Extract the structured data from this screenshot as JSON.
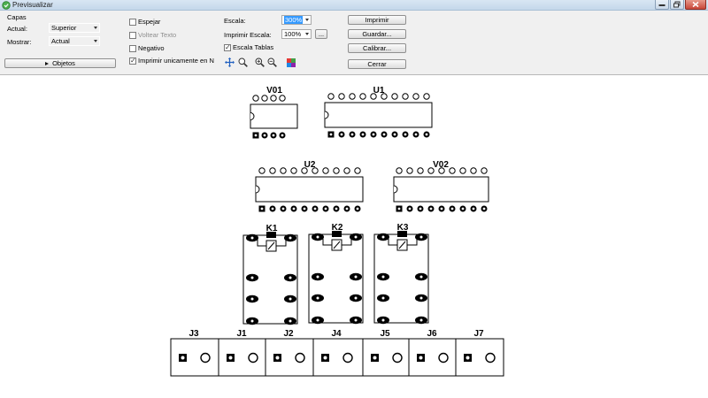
{
  "window": {
    "title": "Previsualizar"
  },
  "capas": {
    "title": "Capas",
    "actual_label": "Actual:",
    "actual_value": "Superior",
    "mostrar_label": "Mostrar:",
    "mostrar_value": "Actual",
    "objetos_button": "Objetos"
  },
  "options": {
    "espejar": {
      "label": "Espejar",
      "checked": false
    },
    "voltear": {
      "label": "Voltear Texto",
      "checked": false,
      "disabled": true
    },
    "negativo": {
      "label": "Negativo",
      "checked": false
    },
    "imprimir_n": {
      "label": "Imprimir unicamente en N",
      "checked": true
    }
  },
  "scale": {
    "escala_label": "Escala:",
    "escala_value": "300%",
    "imprimir_escala_label": "Imprimir Escala:",
    "imprimir_escala_value": "100%",
    "more_button": "...",
    "escala_tablas": {
      "label": "Escala Tablas",
      "checked": true
    }
  },
  "tools": [
    "move-icon",
    "zoom-icon",
    "zoom-in-icon",
    "zoom-out-icon",
    "color-icon"
  ],
  "buttons": {
    "imprimir": "Imprimir",
    "guardar": "Guardar...",
    "calibrar": "Calibrar...",
    "cerrar": "Cerrar"
  },
  "pcb": {
    "ics": [
      "V01",
      "U1",
      "U2",
      "V02"
    ],
    "relays": [
      "K1",
      "K2",
      "K3"
    ],
    "connectors": [
      "J3",
      "J1",
      "J2",
      "J4",
      "J5",
      "J6",
      "J7"
    ]
  }
}
